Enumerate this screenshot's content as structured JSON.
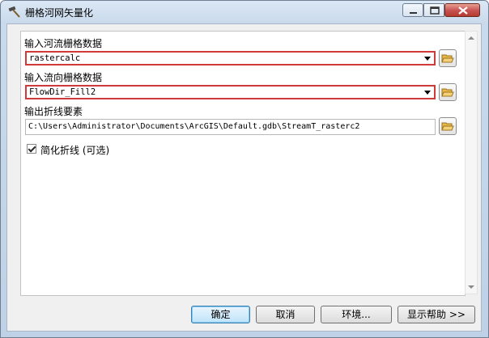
{
  "window": {
    "title": "栅格河网矢量化",
    "icon": "hammer-icon",
    "controls": [
      "help-icon",
      "maximize-icon",
      "close-icon"
    ]
  },
  "form": {
    "input_river_raster": {
      "label": "输入河流栅格数据",
      "value": "rastercalc"
    },
    "input_flowdir_raster": {
      "label": "输入流向栅格数据",
      "value": "FlowDir_Fill2"
    },
    "output_polyline": {
      "label": "输出折线要素",
      "value": "C:\\Users\\Administrator\\Documents\\ArcGIS\\Default.gdb\\StreamT_rasterc2"
    },
    "simplify": {
      "label": "简化折线 (可选)",
      "checked": true
    }
  },
  "buttons": {
    "ok": "确定",
    "cancel": "取消",
    "environments": "环境...",
    "show_help": "显示帮助 >>"
  },
  "colors": {
    "highlight_border": "#d03a3a",
    "default_button": "#bfe3f9"
  }
}
